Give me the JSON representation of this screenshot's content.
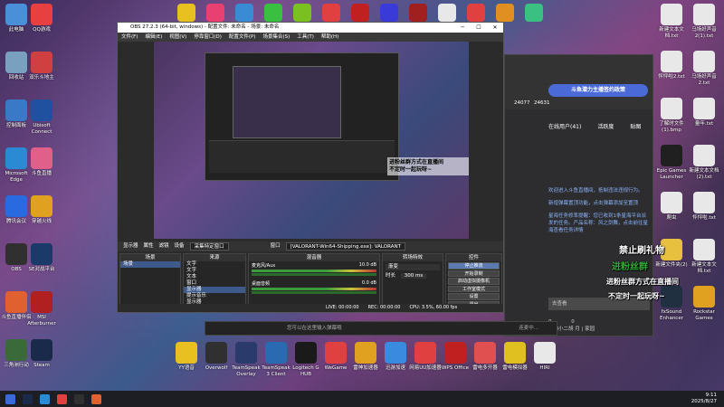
{
  "desktop_left": [
    {
      "label": "此电脑",
      "color": "#4a90d9",
      "icon": "computer-icon"
    },
    {
      "label": "QQ游戏",
      "color": "#e84040",
      "icon": "qqgame-icon"
    },
    {
      "label": "回收站",
      "color": "#7aa0c0",
      "icon": "recycle-icon"
    },
    {
      "label": "双乐斗地主",
      "color": "#d04040",
      "icon": "game-icon"
    },
    {
      "label": "控制面板",
      "color": "#3a78c8",
      "icon": "control-panel-icon"
    },
    {
      "label": "Ubisoft Connect",
      "color": "#2050a0",
      "icon": "ubisoft-icon"
    },
    {
      "label": "Microsoft Edge",
      "color": "#2a8ad4",
      "icon": "edge-icon"
    },
    {
      "label": "斗鱼直播",
      "color": "#e0608a",
      "icon": "douyu-icon"
    },
    {
      "label": "腾讯会议",
      "color": "#2a6ae0",
      "icon": "meeting-icon"
    },
    {
      "label": "穿越火线",
      "color": "#e0a020",
      "icon": "cf-icon"
    },
    {
      "label": "OBS",
      "color": "#303030",
      "icon": "obs-icon"
    },
    {
      "label": "SE对战平台",
      "color": "#1a3a6a",
      "icon": "se-icon"
    },
    {
      "label": "斗鱼直播伴侣",
      "color": "#e06030",
      "icon": "douyu-companion-icon"
    },
    {
      "label": "MSI Afterburner",
      "color": "#b02020",
      "icon": "msi-icon"
    },
    {
      "label": "三角洲行动",
      "color": "#3a6a3a",
      "icon": "delta-icon"
    },
    {
      "label": "Steam",
      "color": "#1a2a4a",
      "icon": "steam-icon"
    }
  ],
  "desktop_right": [
    {
      "label": "新建文本文档.txt",
      "color": "#e8e8e8",
      "icon": "txt-icon"
    },
    {
      "label": "马场好声音2(1).txt",
      "color": "#e8e8e8",
      "icon": "txt-icon"
    },
    {
      "label": "怦怦啦2.txt",
      "color": "#e8e8e8",
      "icon": "txt-icon"
    },
    {
      "label": "马场好声音2.txt",
      "color": "#e8e8e8",
      "icon": "txt-icon"
    },
    {
      "label": "了解时文件(1).bmp",
      "color": "#e8e8e8",
      "icon": "bmp-icon"
    },
    {
      "label": "量年.txt",
      "color": "#e8e8e8",
      "icon": "txt-icon"
    },
    {
      "label": "Epic Games Launcher",
      "color": "#202020",
      "icon": "epic-icon"
    },
    {
      "label": "新建文本文档(2).txt",
      "color": "#e8e8e8",
      "icon": "txt-icon"
    },
    {
      "label": "爬虫",
      "color": "#e8e8e8",
      "icon": "crawler-icon"
    },
    {
      "label": "怦怦啦.txt",
      "color": "#e8e8e8",
      "icon": "txt-icon"
    },
    {
      "label": "新建文件夹(2)",
      "color": "#e8c040",
      "icon": "folder-icon"
    },
    {
      "label": "新建文本文档.txt",
      "color": "#e8e8e8",
      "icon": "txt-icon"
    },
    {
      "label": "fxSound Enhancer",
      "color": "#203040",
      "icon": "fxsound-icon"
    },
    {
      "label": "Rockstar Games",
      "color": "#e0a020",
      "icon": "rockstar-icon"
    }
  ],
  "dock_icons": [
    {
      "label": "YY语音",
      "color": "#e8c020"
    },
    {
      "label": "Overwolf",
      "color": "#303030"
    },
    {
      "label": "TeamSpeak Overlay",
      "color": "#2a3a6a"
    },
    {
      "label": "TeamSpeak 3 Client",
      "color": "#2a6ab0"
    },
    {
      "label": "Logitech G HUB",
      "color": "#1a1a1a"
    },
    {
      "label": "WeGame",
      "color": "#e04040"
    },
    {
      "label": "雷神加速器",
      "color": "#e0a020"
    },
    {
      "label": "迅游加速",
      "color": "#3a8ae0"
    },
    {
      "label": "网易UU加速器",
      "color": "#e04040"
    },
    {
      "label": "WPS Office",
      "color": "#c02020"
    },
    {
      "label": "雷电多开器",
      "color": "#e05050"
    },
    {
      "label": "雷电模拟器",
      "color": "#e0c020"
    },
    {
      "label": "HIRI",
      "color": "#e8e8e8"
    }
  ],
  "obs": {
    "title": "OBS 27.2.3 (64-bit, windows) - 配置文件: 未命名 - 场景: 未命名",
    "menu": [
      "文件(F)",
      "编辑(E)",
      "视图(V)",
      "停靠窗口(D)",
      "配置文件(P)",
      "场景集合(S)",
      "工具(T)",
      "帮助(H)"
    ],
    "source_bar": {
      "label": "显示器",
      "props": "属性",
      "filters": "滤镜",
      "device_label": "设备",
      "device": "采集特定窗口",
      "window_label": "窗口",
      "window": "[VALORANT-Win64-Shipping.exe]: VALORANT"
    },
    "docks": {
      "scenes": {
        "header": "场景",
        "items": [
          "场景"
        ]
      },
      "sources": {
        "header": "来源",
        "items": [
          "文字",
          "文字",
          "文本",
          "窗口",
          "显示器",
          "提示音乐",
          "显示器"
        ]
      },
      "mixer": {
        "header": "混音器",
        "rows": [
          {
            "name": "麦克风/Aux",
            "db": "10.0 dB"
          },
          {
            "name": "桌面音频",
            "db": "0.0 dB"
          }
        ]
      },
      "transitions": {
        "header": "转场特效",
        "type": "渐变",
        "duration_label": "时长",
        "duration": "300 ms"
      },
      "controls": {
        "header": "控件",
        "buttons": [
          "停止推流",
          "开始录制",
          "启动虚拟摄像机",
          "工作室模式",
          "设置",
          "退出"
        ]
      }
    },
    "status": {
      "live": "LIVE: 00:00:00",
      "rec": "REC: 00:00:00",
      "cpu": "CPU: 3.5%, 60.00 fps"
    }
  },
  "right_app": {
    "banner": "斗鱼潜力主播签约政策",
    "tabs": [
      "在线用户(41)",
      "活跃度",
      "贴图"
    ],
    "counts": [
      "24077",
      "24631"
    ],
    "msgs": [
      "欢迎进入斗鱼直播间，抵制违法违规行为。",
      "新增弹幕置顶功能，点击弹幕添加至置顶",
      "星海任务修率提醒：您已收到1条星海平台派发的任务。产品名称：风之剑舞，点击前往星海查看任务详情"
    ],
    "gift": "去查看",
    "footer_counts": [
      "0",
      "0"
    ],
    "footer": "我的小二胡 月 | 家园"
  },
  "overlay": {
    "line1": "禁止刷礼物",
    "line2": "进粉丝群",
    "line3": "进粉丝群方式在直播间",
    "line4": "不定时一起玩呀~"
  },
  "chat": {
    "placeholder": "您可以在这里输入弹幕哦",
    "send": "连麦中..."
  },
  "tray": {
    "time": "9:11",
    "date": "2025/8/27"
  }
}
